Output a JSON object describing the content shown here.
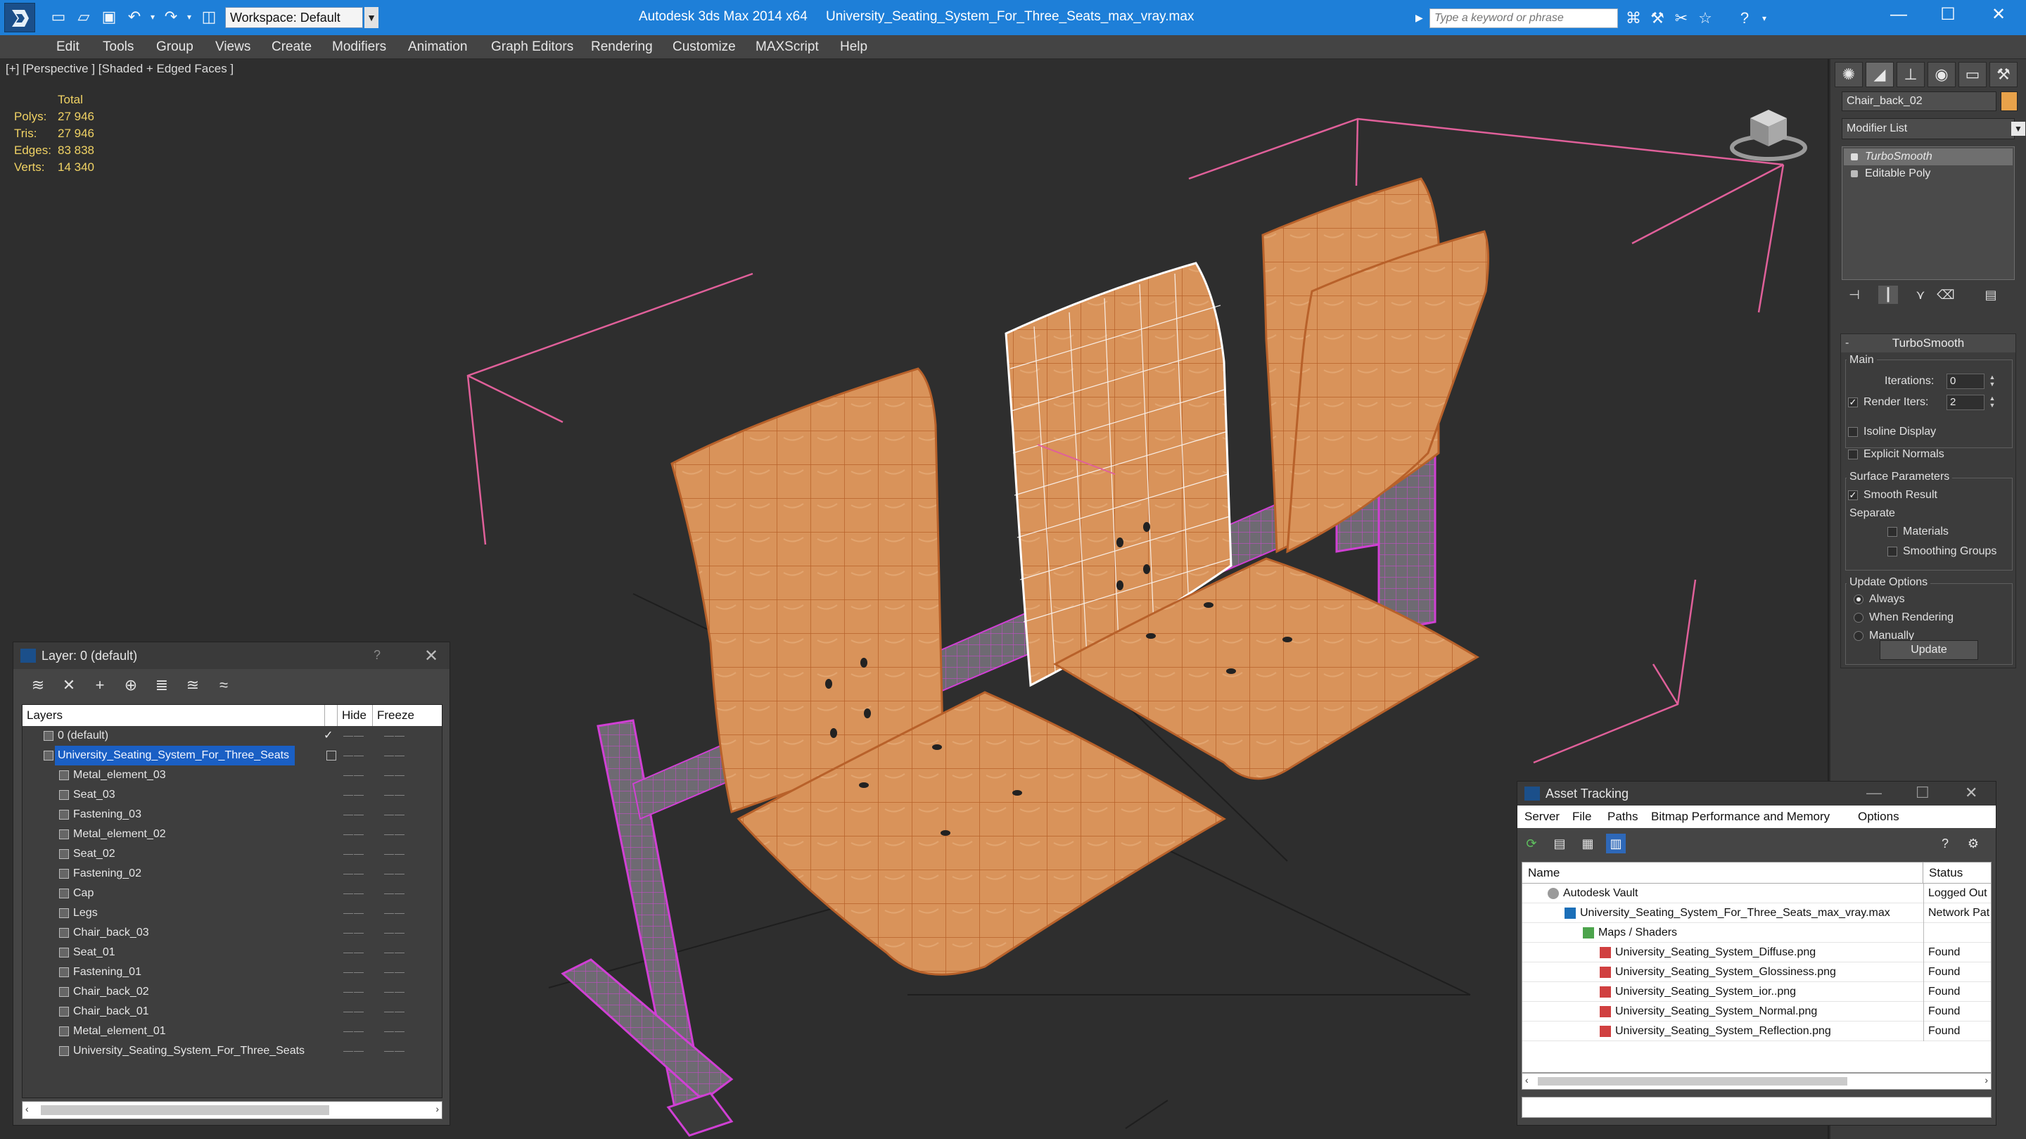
{
  "window": {
    "app_title": "Autodesk 3ds Max  2014 x64",
    "file_title": "University_Seating_System_For_Three_Seats_max_vray.max",
    "workspace": "Workspace: Default",
    "search_placeholder": "Type a keyword or phrase",
    "minimize": "—",
    "maximize": "☐",
    "close": "✕"
  },
  "menu": [
    "Edit",
    "Tools",
    "Group",
    "Views",
    "Create",
    "Modifiers",
    "Animation",
    "Graph Editors",
    "Rendering",
    "Customize",
    "MAXScript",
    "Help"
  ],
  "viewport": {
    "label": "[+] [Perspective ] [Shaded + Edged Faces ]",
    "stats_header": "Total",
    "stats": [
      {
        "label": "Polys:",
        "value": "27 946"
      },
      {
        "label": "Tris:",
        "value": "27 946"
      },
      {
        "label": "Edges:",
        "value": "83 838"
      },
      {
        "label": "Verts:",
        "value": "14 340"
      }
    ]
  },
  "command_panel": {
    "object_name": "Chair_back_02",
    "modifier_list": "Modifier List",
    "stack": [
      "TurboSmooth",
      "Editable Poly"
    ],
    "rollout_title": "TurboSmooth",
    "main_group": "Main",
    "iterations_label": "Iterations:",
    "iterations_value": "0",
    "render_iters_label": "Render Iters:",
    "render_iters_value": "2",
    "isoline": "Isoline Display",
    "explicit_normals": "Explicit Normals",
    "surface_group": "Surface Parameters",
    "smooth_result": "Smooth Result",
    "separate": "Separate",
    "materials": "Materials",
    "smoothing_groups": "Smoothing Groups",
    "update_group": "Update Options",
    "always": "Always",
    "when_rendering": "When Rendering",
    "manually": "Manually",
    "update_button": "Update"
  },
  "layer_dialog": {
    "title": "Layer: 0 (default)",
    "help": "?",
    "close": "✕",
    "col_layers": "Layers",
    "col_hide": "Hide",
    "col_freeze": "Freeze",
    "rows": [
      {
        "name": "0 (default)"
      },
      {
        "name": "University_Seating_System_For_Three_Seats"
      },
      {
        "name": "Metal_element_03"
      },
      {
        "name": "Seat_03"
      },
      {
        "name": "Fastening_03"
      },
      {
        "name": "Metal_element_02"
      },
      {
        "name": "Seat_02"
      },
      {
        "name": "Fastening_02"
      },
      {
        "name": "Cap"
      },
      {
        "name": "Legs"
      },
      {
        "name": "Chair_back_03"
      },
      {
        "name": "Seat_01"
      },
      {
        "name": "Fastening_01"
      },
      {
        "name": "Chair_back_02"
      },
      {
        "name": "Chair_back_01"
      },
      {
        "name": "Metal_element_01"
      },
      {
        "name": "University_Seating_System_For_Three_Seats"
      }
    ],
    "dash": "——"
  },
  "asset_dialog": {
    "title": "Asset Tracking",
    "menu": [
      "Server",
      "File",
      "Paths",
      "Bitmap Performance and Memory",
      "Options"
    ],
    "col_name": "Name",
    "col_status": "Status",
    "rows": [
      {
        "name": "Autodesk Vault",
        "status": "Logged Out"
      },
      {
        "name": "University_Seating_System_For_Three_Seats_max_vray.max",
        "status": "Network Pat"
      },
      {
        "name": "Maps / Shaders",
        "status": ""
      },
      {
        "name": "University_Seating_System_Diffuse.png",
        "status": "Found"
      },
      {
        "name": "University_Seating_System_Glossiness.png",
        "status": "Found"
      },
      {
        "name": "University_Seating_System_ior..png",
        "status": "Found"
      },
      {
        "name": "University_Seating_System_Normal.png",
        "status": "Found"
      },
      {
        "name": "University_Seating_System_Reflection.png",
        "status": "Found"
      }
    ]
  },
  "colors": {
    "titlebar": "#1e7fd8",
    "wood": "#d9935a",
    "selection_pink": "#e0609a",
    "metal_magenta": "#c24cc4",
    "stats_yellow": "#f0d264"
  }
}
